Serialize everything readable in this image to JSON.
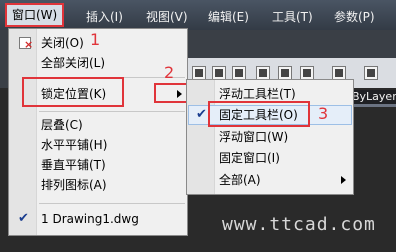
{
  "menubar": {
    "items": [
      "窗口(W)",
      "插入(I)",
      "视图(V)",
      "编辑(E)",
      "工具(T)",
      "参数(P)"
    ]
  },
  "window_menu": {
    "items": [
      {
        "label": "关闭(O)",
        "icon": "close-window-icon"
      },
      {
        "label": "全部关闭(L)"
      },
      {
        "label": "锁定位置(K)",
        "has_submenu": true
      },
      {
        "label": "层叠(C)"
      },
      {
        "label": "水平平铺(H)"
      },
      {
        "label": "垂直平铺(T)"
      },
      {
        "label": "排列图标(A)"
      },
      {
        "label": "1 Drawing1.dwg",
        "checked": true
      }
    ]
  },
  "lock_submenu": {
    "items": [
      {
        "label": "浮动工具栏(T)"
      },
      {
        "label": "固定工具栏(O)",
        "checked": true
      },
      {
        "label": "浮动窗口(W)"
      },
      {
        "label": "固定窗口(I)"
      },
      {
        "label": "全部(A)",
        "has_submenu": true
      }
    ]
  },
  "annotations": {
    "n1": "1",
    "n2": "2",
    "n3": "3"
  },
  "layer_combo": "ByLayer",
  "watermark": "www.ttcad.com",
  "colors": {
    "highlight_red": "#e0343a",
    "menubar_bg": "#3d4653",
    "menu_bg": "#f0f0f0"
  }
}
